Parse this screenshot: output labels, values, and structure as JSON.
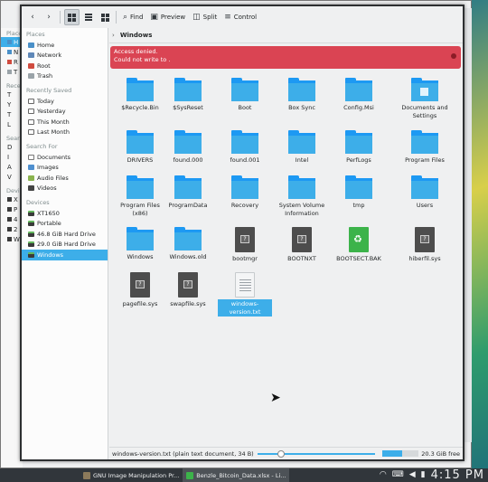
{
  "back_window": {
    "section_places": "Place",
    "places": [
      "H",
      "N",
      "R",
      "T"
    ],
    "section_recent": "Rece",
    "recent": [
      "T",
      "Y",
      "T",
      "L"
    ],
    "section_search": "Searc",
    "search": [
      "D",
      "I",
      "A",
      "V"
    ],
    "section_devices": "Devi",
    "devices": [
      "X",
      "P",
      "4",
      "2",
      "W"
    ],
    "footer_fragment": "ophin"
  },
  "toolbar": {
    "back_icon": "chevron-left-icon",
    "forward_icon": "chevron-right-icon",
    "find_label": "Find",
    "preview_label": "Preview",
    "split_label": "Split",
    "control_label": "Control"
  },
  "sidebar": {
    "places_header": "Places",
    "places": [
      {
        "label": "Home",
        "icon": "home-icon"
      },
      {
        "label": "Network",
        "icon": "network-icon"
      },
      {
        "label": "Root",
        "icon": "root-folder-icon"
      },
      {
        "label": "Trash",
        "icon": "trash-icon"
      }
    ],
    "recent_header": "Recently Saved",
    "recent": [
      {
        "label": "Today"
      },
      {
        "label": "Yesterday"
      },
      {
        "label": "This Month"
      },
      {
        "label": "Last Month"
      }
    ],
    "search_header": "Search For",
    "search": [
      {
        "label": "Documents"
      },
      {
        "label": "Images"
      },
      {
        "label": "Audio Files"
      },
      {
        "label": "Videos"
      }
    ],
    "devices_header": "Devices",
    "devices": [
      {
        "label": "XT1650"
      },
      {
        "label": "Portable"
      },
      {
        "label": "46.8 GiB Hard Drive"
      },
      {
        "label": "29.0 GiB Hard Drive"
      },
      {
        "label": "Windows",
        "selected": true
      }
    ]
  },
  "breadcrumb": {
    "separator": "›",
    "current": "Windows"
  },
  "alert": {
    "line1": "Access denied.",
    "line2": "Could not write to ."
  },
  "files": [
    {
      "label": "$Recycle.Bin",
      "type": "folder"
    },
    {
      "label": "$SysReset",
      "type": "folder"
    },
    {
      "label": "Boot",
      "type": "folder"
    },
    {
      "label": "Box Sync",
      "type": "folder"
    },
    {
      "label": "Config.Msi",
      "type": "folder"
    },
    {
      "label": "Documents and Settings",
      "type": "folder-special"
    },
    {
      "label": "DRIVERS",
      "type": "folder"
    },
    {
      "label": "found.000",
      "type": "folder"
    },
    {
      "label": "found.001",
      "type": "folder"
    },
    {
      "label": "Intel",
      "type": "folder"
    },
    {
      "label": "PerfLogs",
      "type": "folder"
    },
    {
      "label": "Program Files",
      "type": "folder"
    },
    {
      "label": "Program Files (x86)",
      "type": "folder"
    },
    {
      "label": "ProgramData",
      "type": "folder"
    },
    {
      "label": "Recovery",
      "type": "folder"
    },
    {
      "label": "System Volume Information",
      "type": "folder"
    },
    {
      "label": "tmp",
      "type": "folder"
    },
    {
      "label": "Users",
      "type": "folder"
    },
    {
      "label": "Windows",
      "type": "folder"
    },
    {
      "label": "Windows.old",
      "type": "folder"
    },
    {
      "label": "bootmgr",
      "type": "file"
    },
    {
      "label": "BOOTNXT",
      "type": "file"
    },
    {
      "label": "BOOTSECT.BAK",
      "type": "file-bak"
    },
    {
      "label": "hiberfil.sys",
      "type": "file"
    },
    {
      "label": "pagefile.sys",
      "type": "file"
    },
    {
      "label": "swapfile.sys",
      "type": "file"
    },
    {
      "label": "windows-version.txt",
      "type": "file-txt",
      "selected": true
    }
  ],
  "status": {
    "text": "windows-version.txt (plain text document, 34 B)",
    "zoom_fraction": 0.18,
    "free_space": "20.3 GiB free",
    "used_fraction": 0.55
  },
  "taskbar": {
    "apps": [
      {
        "label": "GNU Image Manipulation Pr...",
        "icon": "gimp-icon"
      },
      {
        "label": "Benzle_Bitcoin_Data.xlsx - Li...",
        "icon": "spreadsheet-icon",
        "active": true
      }
    ],
    "clock": "4:15 PM"
  }
}
